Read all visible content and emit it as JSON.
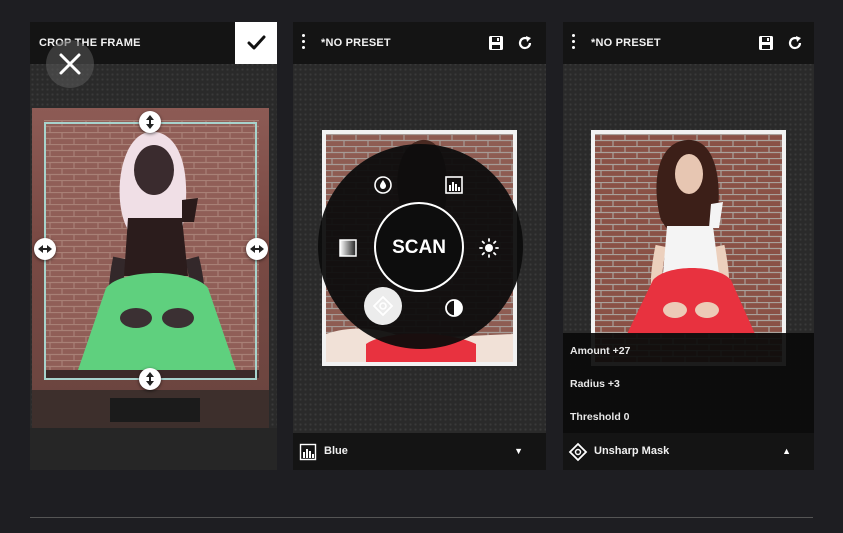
{
  "crop_screen": {
    "title": "CROP THE FRAME",
    "confirm_icon": "check-icon",
    "close_icon": "close-icon"
  },
  "scan_screen": {
    "preset_title": "*NO PRESET",
    "menu_icon": "more-vert-icon",
    "save_icon": "save-icon",
    "reset_icon": "refresh-icon",
    "radial_center_label": "SCAN",
    "radial_tools": [
      "drop-icon",
      "histogram-icon",
      "gradient-icon",
      "brightness-icon",
      "sharpen-icon",
      "contrast-icon"
    ],
    "bottom_label": "Blue",
    "bottom_icon": "histogram-icon",
    "bottom_caret": "▼"
  },
  "sharpen_screen": {
    "preset_title": "*NO PRESET",
    "menu_icon": "more-vert-icon",
    "save_icon": "save-icon",
    "reset_icon": "refresh-icon",
    "params": [
      {
        "label": "Amount +27"
      },
      {
        "label": "Radius +3"
      },
      {
        "label": "Threshold 0"
      }
    ],
    "bottom_label": "Unsharp Mask",
    "bottom_icon": "sharpen-icon",
    "bottom_caret": "▲"
  },
  "colors": {
    "background": "#1e1e22",
    "bar": "#141414",
    "crop_frame": "#a7d3cc",
    "skirt_negative": "#5fd07e",
    "skirt": "#e8323f"
  }
}
